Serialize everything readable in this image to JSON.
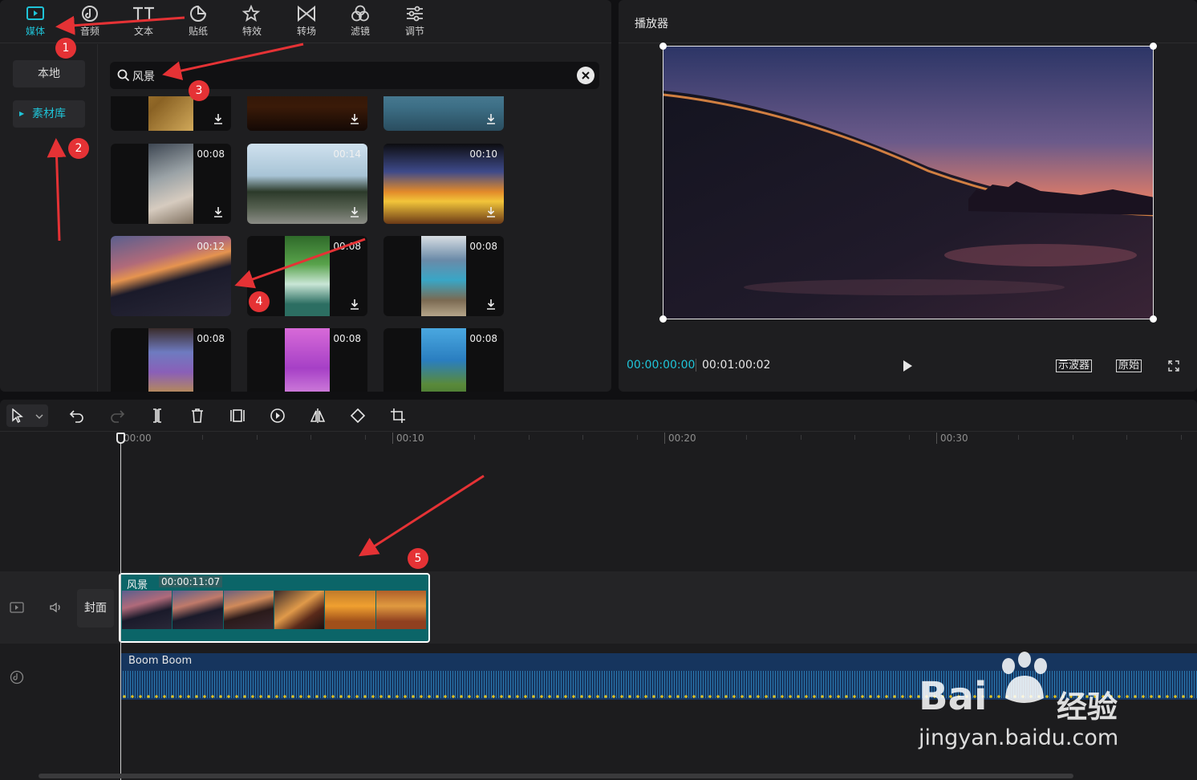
{
  "top_tabs": [
    {
      "label": "媒体",
      "icon": "media-icon",
      "active": true
    },
    {
      "label": "音频",
      "icon": "audio-icon"
    },
    {
      "label": "文本",
      "icon": "text-icon"
    },
    {
      "label": "贴纸",
      "icon": "sticker-icon"
    },
    {
      "label": "特效",
      "icon": "effects-icon"
    },
    {
      "label": "转场",
      "icon": "transition-icon"
    },
    {
      "label": "滤镜",
      "icon": "filter-icon"
    },
    {
      "label": "调节",
      "icon": "adjust-icon"
    }
  ],
  "sidebar": {
    "local": "本地",
    "library": "素材库"
  },
  "search": {
    "value": "风景"
  },
  "media_tiles": [
    {
      "duration": ""
    },
    {
      "duration": ""
    },
    {
      "duration": ""
    },
    {
      "duration": "00:08"
    },
    {
      "duration": "00:14"
    },
    {
      "duration": "00:10"
    },
    {
      "duration": "00:12"
    },
    {
      "duration": "00:08"
    },
    {
      "duration": "00:08"
    },
    {
      "duration": "00:08"
    },
    {
      "duration": "00:08"
    },
    {
      "duration": "00:08"
    }
  ],
  "annotations": [
    "1",
    "2",
    "3",
    "4",
    "5"
  ],
  "player": {
    "title": "播放器",
    "time_current": "00:00:00:00",
    "time_total": "00:01:00:02",
    "oscilloscope": "示波器",
    "original": "原始"
  },
  "timeline": {
    "ruler": [
      "00:00",
      "00:10",
      "00:20",
      "00:30"
    ],
    "cover": "封面",
    "clip_name": "风景",
    "clip_duration": "00:00:11:07",
    "audio_name": "Boom Boom"
  },
  "watermark": {
    "brand": "Bai",
    "brand_cn": "经验",
    "url": "jingyan.baidu.com"
  },
  "colors": {
    "accent": "#1fc4d8",
    "annotation": "#e53235",
    "clip": "#0b6568",
    "audio": "#16355e"
  }
}
